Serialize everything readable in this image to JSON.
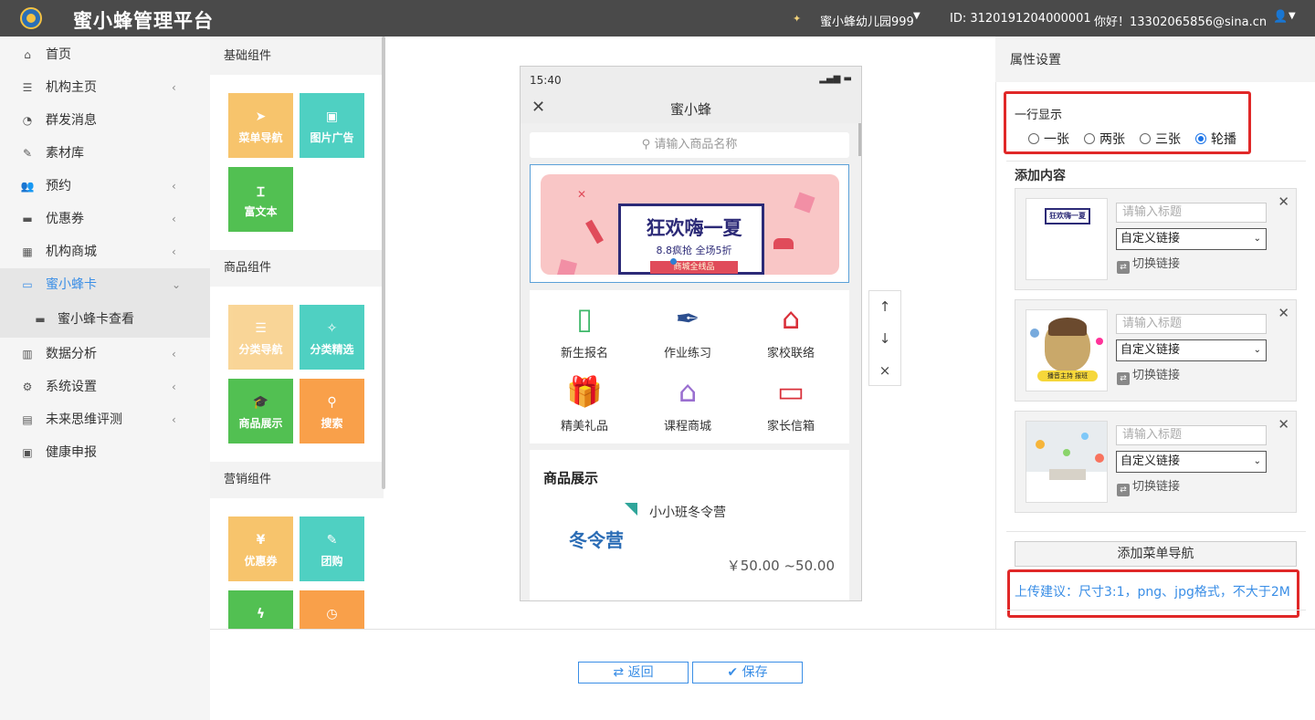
{
  "topbar": {
    "brand": "蜜小蜂管理平台",
    "school": "蜜小蜂幼儿园999",
    "id_text": "ID:  3120191204000001",
    "greeting": "你好！13302065856@sina.cn"
  },
  "sidebar": {
    "items": [
      {
        "label": "首页",
        "icon": "home-icon",
        "glyph": "⌂"
      },
      {
        "label": "机构主页",
        "icon": "list-icon",
        "glyph": "☰"
      },
      {
        "label": "群发消息",
        "icon": "chat-icon",
        "glyph": "◔"
      },
      {
        "label": "素材库",
        "icon": "edit-icon",
        "glyph": "✎"
      },
      {
        "label": "预约",
        "icon": "users-icon",
        "glyph": "👥"
      },
      {
        "label": "优惠券",
        "icon": "ticket-icon",
        "glyph": "▬"
      },
      {
        "label": "机构商城",
        "icon": "building-icon",
        "glyph": "▦"
      },
      {
        "label": "蜜小蜂卡",
        "icon": "card-icon",
        "glyph": "▭"
      },
      {
        "label": "蜜小蜂卡查看",
        "icon": "card-view-icon",
        "glyph": "▬"
      },
      {
        "label": "数据分析",
        "icon": "bar-chart-icon",
        "glyph": "▥"
      },
      {
        "label": "系统设置",
        "icon": "cogs-icon",
        "glyph": "⚙"
      },
      {
        "label": "未来思维评测",
        "icon": "document-icon",
        "glyph": "▤"
      },
      {
        "label": "健康申报",
        "icon": "id-card-icon",
        "glyph": "▣"
      }
    ]
  },
  "palette": {
    "basic": {
      "title": "基础组件",
      "tiles": [
        {
          "label": "菜单导航",
          "glyph": "➤"
        },
        {
          "label": "图片广告",
          "glyph": "▣"
        },
        {
          "label": "富文本",
          "glyph": "Ɪ"
        }
      ]
    },
    "goods": {
      "title": "商品组件",
      "tiles": [
        {
          "label": "分类导航",
          "glyph": "☰"
        },
        {
          "label": "分类精选",
          "glyph": "✧"
        },
        {
          "label": "商品展示",
          "glyph": "🎓"
        },
        {
          "label": "搜索",
          "glyph": "⚲"
        }
      ]
    },
    "marketing": {
      "title": "营销组件",
      "tiles": [
        {
          "label": "优惠券",
          "glyph": "¥"
        },
        {
          "label": "团购",
          "glyph": "✎"
        },
        {
          "label": "",
          "glyph": "ϟ"
        },
        {
          "label": "",
          "glyph": "◷"
        }
      ]
    }
  },
  "phone": {
    "time": "15:40",
    "title": "蜜小蜂",
    "search_placeholder": "请输入商品名称",
    "banner": {
      "title": "狂欢嗨一夏",
      "subtitle": "8.8疯抢  全场5折",
      "tag": "商城全线品"
    },
    "grid": [
      {
        "label": "新生报名",
        "icon": "enroll-icon",
        "glyph": "▯",
        "color": "#3fb86a"
      },
      {
        "label": "作业练习",
        "icon": "pen-icon",
        "glyph": "✒",
        "color": "#2c4f8f"
      },
      {
        "label": "家校联络",
        "icon": "house-star-icon",
        "glyph": "⌂",
        "color": "#d9303a"
      },
      {
        "label": "精美礼品",
        "icon": "gift-icon",
        "glyph": "🎁",
        "color": "#d42a7f"
      },
      {
        "label": "课程商城",
        "icon": "shop-icon",
        "glyph": "⌂",
        "color": "#9a6fd0"
      },
      {
        "label": "家长信箱",
        "icon": "heart-doc-icon",
        "glyph": "▭",
        "color": "#d9303a"
      }
    ],
    "goods": {
      "heading": "商品展示",
      "image_text": "冬令营",
      "name": "小小班冬令营",
      "price": "￥50.00 ~50.00"
    }
  },
  "mover": {
    "up": "↑",
    "down": "↓",
    "remove": "×"
  },
  "props": {
    "title": "属性设置",
    "row_label": "一行显示",
    "options": [
      "一张",
      "两张",
      "三张",
      "轮播"
    ],
    "selected": "轮播",
    "add_content": "添加内容",
    "cards": [
      {
        "title_placeholder": "请输入标题",
        "link_value": "自定义链接",
        "switch_label": "切换链接",
        "thumb_text": "狂欢嗨一夏"
      },
      {
        "title_placeholder": "请输入标题",
        "link_value": "自定义链接",
        "switch_label": "切换链接",
        "thumb_text": "播音主持  报班"
      },
      {
        "title_placeholder": "请输入标题",
        "link_value": "自定义链接",
        "switch_label": "切换链接",
        "thumb_text": ""
      }
    ],
    "add_nav": "添加菜单导航",
    "hint": "上传建议：尺寸3:1，png、jpg格式，不大于2M"
  },
  "footer": {
    "back": "⇄ 返回",
    "save": "✔ 保存"
  },
  "colors": {
    "accent": "#3a8ee6",
    "highlight": "#e02828",
    "topbar": "#4a4a4a"
  }
}
